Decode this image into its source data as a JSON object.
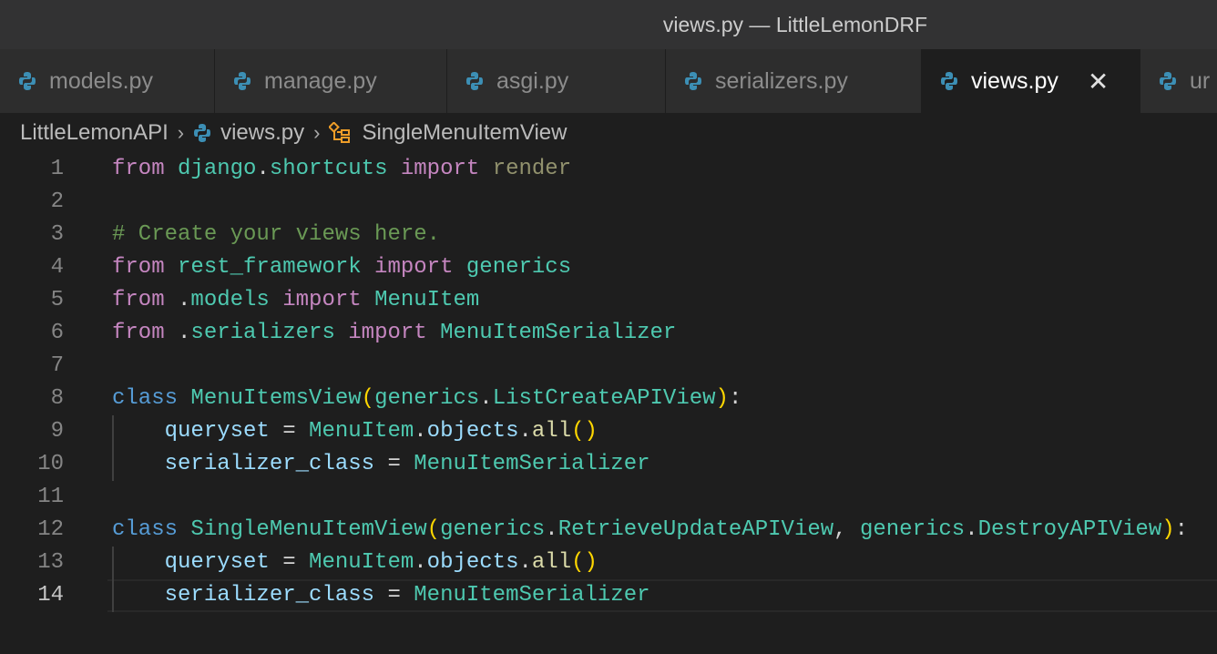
{
  "window": {
    "title": "views.py — LittleLemonDRF"
  },
  "tabs": [
    {
      "label": "models.py",
      "w": 236
    },
    {
      "label": "manage.py",
      "w": 255
    },
    {
      "label": "asgi.py",
      "w": 240
    },
    {
      "label": "serializers.py",
      "w": 281
    },
    {
      "label": "views.py",
      "active": true,
      "w": 240
    },
    {
      "label": "ur",
      "w": 120
    }
  ],
  "breadcrumb": {
    "folder": "LittleLemonAPI",
    "file": "views.py",
    "symbol": "SingleMenuItemView"
  },
  "colors": {
    "python_icon": "#3c8fb5",
    "symbol_icon": "#ee9d28"
  },
  "code": {
    "current_line": 14,
    "lines": [
      [
        [
          "from",
          "kw"
        ],
        [
          " django",
          "mod"
        ],
        [
          ".",
          "op"
        ],
        [
          "shortcuts",
          "mod"
        ],
        [
          " import",
          "kw"
        ],
        [
          " render",
          "dim"
        ]
      ],
      [],
      [
        [
          "# Create your views here.",
          "cm"
        ]
      ],
      [
        [
          "from",
          "kw"
        ],
        [
          " rest_framework",
          "mod"
        ],
        [
          " import",
          "kw"
        ],
        [
          " generics",
          "mod"
        ]
      ],
      [
        [
          "from",
          "kw"
        ],
        [
          " .",
          "op"
        ],
        [
          "models",
          "mod"
        ],
        [
          " import",
          "kw"
        ],
        [
          " MenuItem",
          "mod"
        ]
      ],
      [
        [
          "from",
          "kw"
        ],
        [
          " .",
          "op"
        ],
        [
          "serializers",
          "mod"
        ],
        [
          " import",
          "kw"
        ],
        [
          " MenuItemSerializer",
          "mod"
        ]
      ],
      [],
      [
        [
          "class",
          "st"
        ],
        [
          " MenuItemsView",
          "mod"
        ],
        [
          "(",
          "br"
        ],
        [
          "generics",
          "mod"
        ],
        [
          ".",
          "op"
        ],
        [
          "ListCreateAPIView",
          "mod"
        ],
        [
          ")",
          "br"
        ],
        [
          ":",
          "op"
        ]
      ],
      [
        [
          "    queryset",
          "var"
        ],
        [
          " = ",
          "op"
        ],
        [
          "MenuItem",
          "mod"
        ],
        [
          ".",
          "op"
        ],
        [
          "objects",
          "var"
        ],
        [
          ".",
          "op"
        ],
        [
          "all",
          "fn"
        ],
        [
          "()",
          "br"
        ]
      ],
      [
        [
          "    serializer_class",
          "var"
        ],
        [
          " = ",
          "op"
        ],
        [
          "MenuItemSerializer",
          "mod"
        ]
      ],
      [],
      [
        [
          "class",
          "st"
        ],
        [
          " SingleMenuItemView",
          "mod"
        ],
        [
          "(",
          "br"
        ],
        [
          "generics",
          "mod"
        ],
        [
          ".",
          "op"
        ],
        [
          "RetrieveUpdateAPIView",
          "mod"
        ],
        [
          ", ",
          "op"
        ],
        [
          "generics",
          "mod"
        ],
        [
          ".",
          "op"
        ],
        [
          "DestroyAPIView",
          "mod"
        ],
        [
          ")",
          "br"
        ],
        [
          ":",
          "op"
        ]
      ],
      [
        [
          "    queryset",
          "var"
        ],
        [
          " = ",
          "op"
        ],
        [
          "MenuItem",
          "mod"
        ],
        [
          ".",
          "op"
        ],
        [
          "objects",
          "var"
        ],
        [
          ".",
          "op"
        ],
        [
          "all",
          "fn"
        ],
        [
          "()",
          "br"
        ]
      ],
      [
        [
          "    serializer_class",
          "var"
        ],
        [
          " = ",
          "op"
        ],
        [
          "MenuItemSerializer",
          "mod"
        ]
      ]
    ],
    "guide_lines": [
      9,
      10,
      13,
      14
    ]
  }
}
